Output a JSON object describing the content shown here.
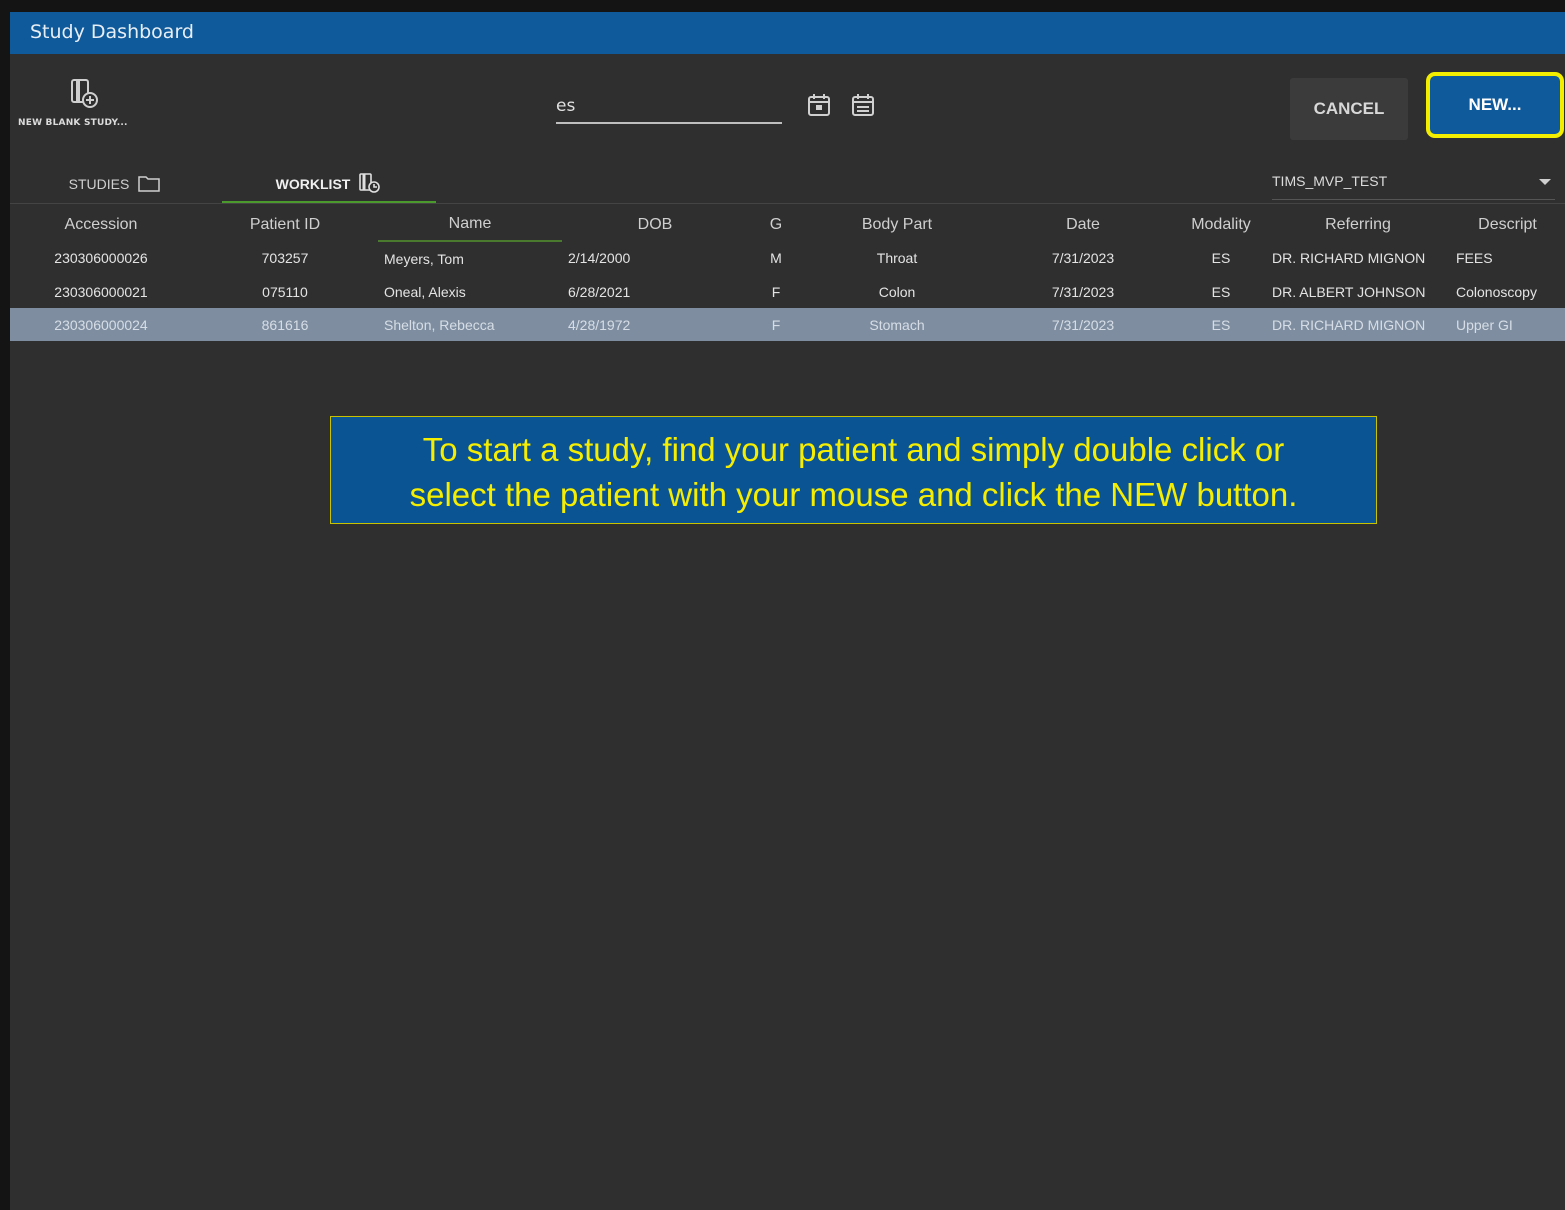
{
  "window": {
    "title": "Study Dashboard"
  },
  "toolbar": {
    "new_blank_study_label": "NEW BLANK STUDY...",
    "search_value": "es",
    "cancel_label": "CANCEL",
    "new_label": "NEW...",
    "highlight_color": "#f3ee00"
  },
  "tabs": [
    {
      "label": "STUDIES",
      "icon": "folder-icon"
    },
    {
      "label": "WORKLIST",
      "icon": "worklist-icon",
      "active": true
    }
  ],
  "site_dropdown": {
    "value": "TIMS_MVP_TEST"
  },
  "table": {
    "columns": [
      "Accession",
      "Patient ID",
      "Name",
      "DOB",
      "G",
      "Body Part",
      "Date",
      "Modality",
      "Referring",
      "Descript"
    ],
    "rows": [
      [
        "230306000026",
        "703257",
        "Meyers, Tom",
        "2/14/2000",
        "M",
        "Throat",
        "7/31/2023",
        "ES",
        "DR. RICHARD MIGNON",
        "FEES"
      ],
      [
        "230306000021",
        "075110",
        "Oneal, Alexis",
        "6/28/2021",
        "F",
        "Colon",
        "7/31/2023",
        "ES",
        "DR. ALBERT JOHNSON",
        "Colonoscopy"
      ],
      [
        "230306000024",
        "861616",
        "Shelton, Rebecca",
        "4/28/1972",
        "F",
        "Stomach",
        "7/31/2023",
        "ES",
        "DR. RICHARD MIGNON",
        "Upper GI"
      ]
    ],
    "selected_row": 2
  },
  "callout": {
    "line1": "To start a study, find your patient and simply double click or",
    "line2": "select the patient with your mouse and click the NEW button."
  }
}
